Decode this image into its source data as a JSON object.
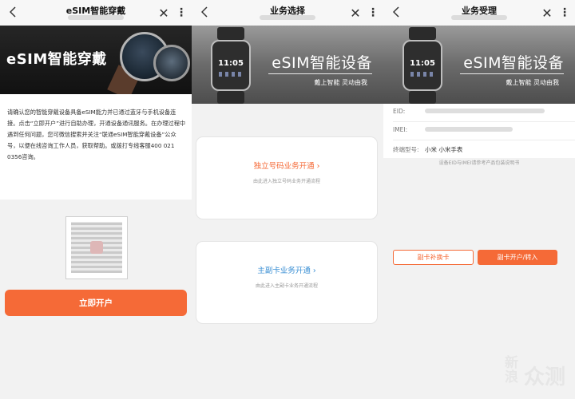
{
  "panels": [
    {
      "topbar": {
        "title": "eSIM智能穿戴"
      },
      "banner": {
        "text": "eSIM智能穿戴"
      },
      "intro_text": "请确认您的智能穿戴设备具备eSIM能力并已通过蓝牙与手机设备连接。点击“立即开户”进行自助办理，开通设备通讯服务。在办理过程中遇到任何问题，您可微信搜索并关注“联通eSIM智能穿戴设备”公众号，以便在线咨询工作人员，获取帮助。或拨打专线客服400 021 0356咨询。",
      "primary_button": "立即开户"
    },
    {
      "topbar": {
        "title": "业务选择"
      },
      "banner": {
        "text": "eSIM智能设备",
        "slogan": "戴上智能 灵动由我"
      },
      "watch_time": "11:05",
      "cards": [
        {
          "label": "独立号码业务开通 ›",
          "desc": "由此进入独立号码业务开通流程"
        },
        {
          "label": "主副卡业务开通 ›",
          "desc": "由此进入主副卡业务开通流程"
        }
      ]
    },
    {
      "topbar": {
        "title": "业务受理"
      },
      "banner": {
        "text": "eSIM智能设备",
        "slogan": "戴上智能 灵动由我"
      },
      "watch_time": "11:05",
      "info": [
        {
          "key": "EID:",
          "value": ""
        },
        {
          "key": "IMEI:",
          "value": ""
        },
        {
          "key": "终端型号:",
          "value": "小米 小米手表"
        }
      ],
      "hint": "设备EID与IMEI请参考产品包装说明书",
      "buttons": {
        "left": "副卡补换卡",
        "right": "副卡开户/转入"
      }
    }
  ],
  "icons": {
    "back": "chevron-left-icon",
    "close": "close-icon",
    "more": "more-vertical-icon"
  },
  "watermark": {
    "line1": "新浪",
    "line2": "众测"
  },
  "colors": {
    "accent": "#f56a37",
    "link_blue": "#3a8fd4"
  }
}
